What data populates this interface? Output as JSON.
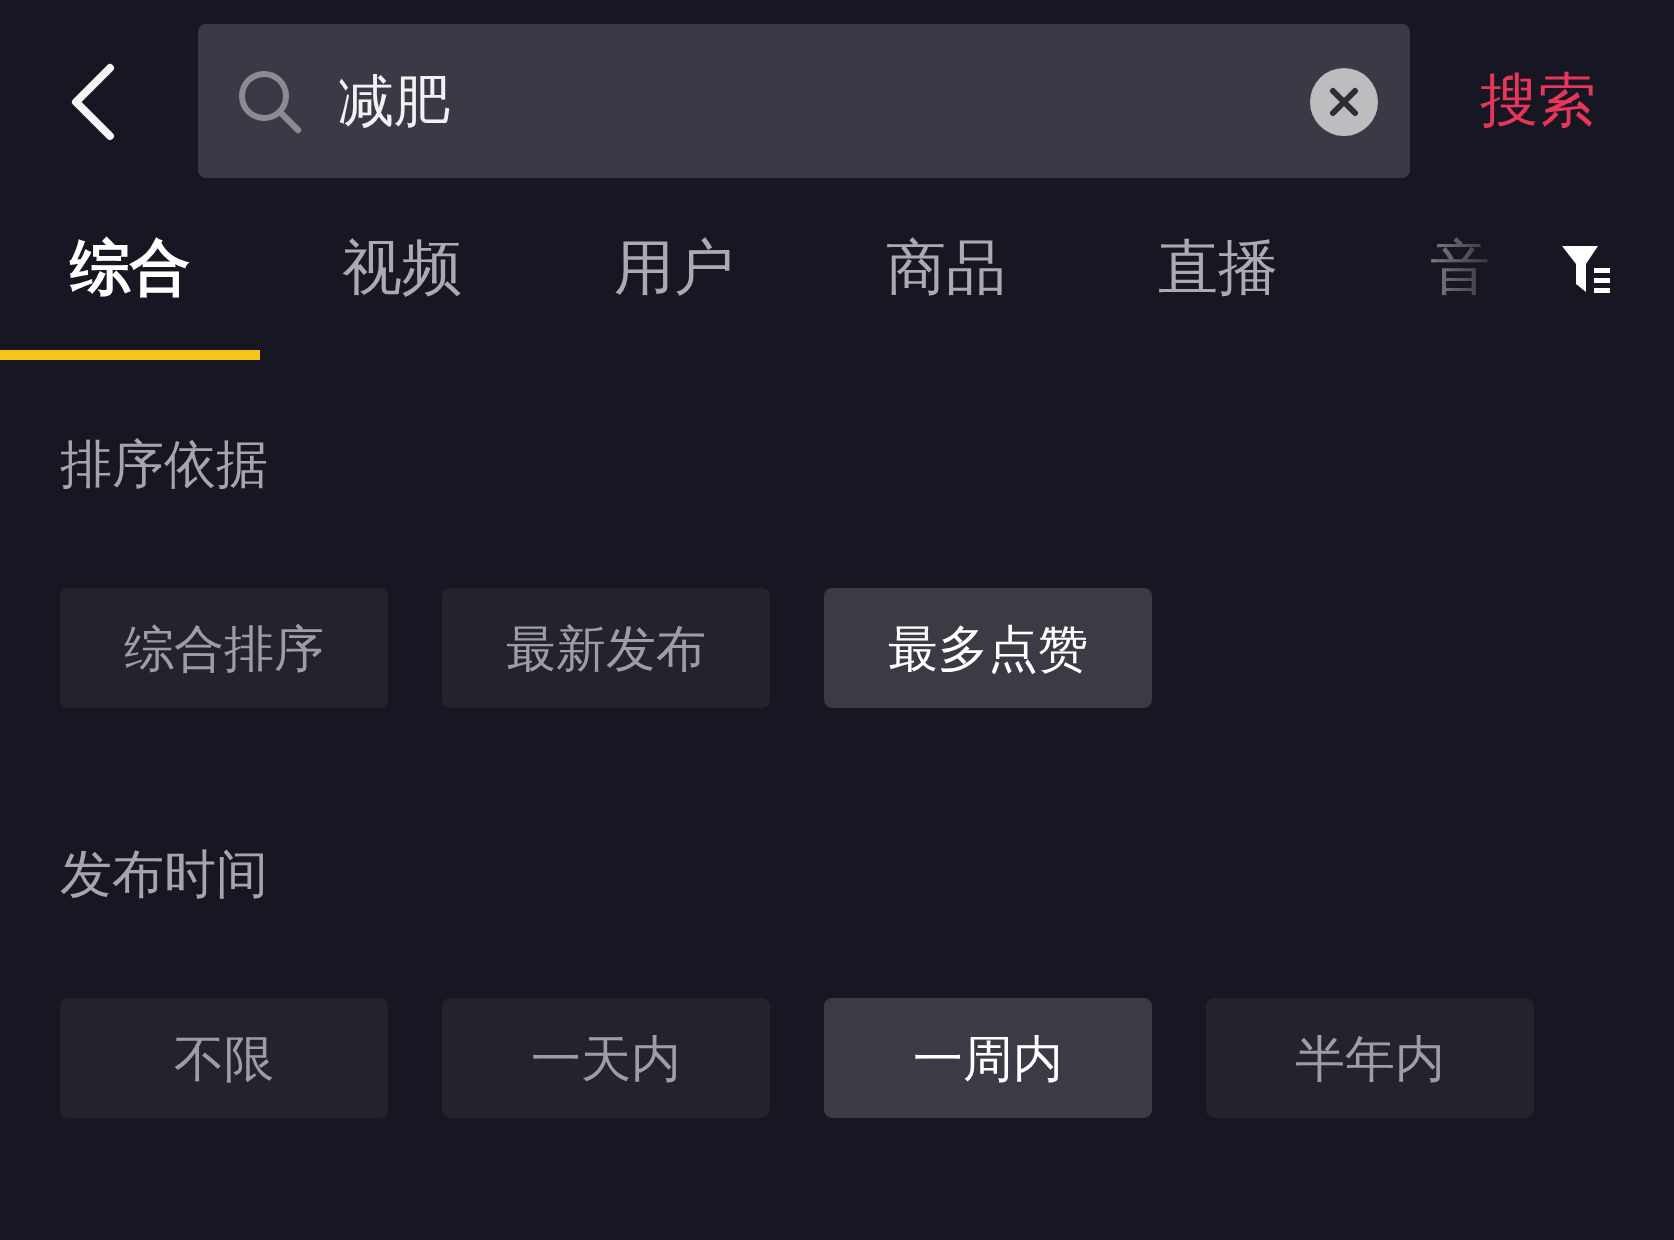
{
  "header": {
    "search": {
      "value": "减肥"
    },
    "search_button": "搜索"
  },
  "tabs": [
    {
      "label": "综合",
      "selected": true
    },
    {
      "label": "视频",
      "selected": false
    },
    {
      "label": "用户",
      "selected": false
    },
    {
      "label": "商品",
      "selected": false
    },
    {
      "label": "直播",
      "selected": false
    },
    {
      "label": "音",
      "selected": false
    }
  ],
  "filters": [
    {
      "title": "排序依据",
      "options": [
        {
          "label": "综合排序",
          "selected": false
        },
        {
          "label": "最新发布",
          "selected": false
        },
        {
          "label": "最多点赞",
          "selected": true
        }
      ]
    },
    {
      "title": "发布时间",
      "options": [
        {
          "label": "不限",
          "selected": false
        },
        {
          "label": "一天内",
          "selected": false
        },
        {
          "label": "一周内",
          "selected": true
        },
        {
          "label": "半年内",
          "selected": false
        }
      ]
    }
  ]
}
